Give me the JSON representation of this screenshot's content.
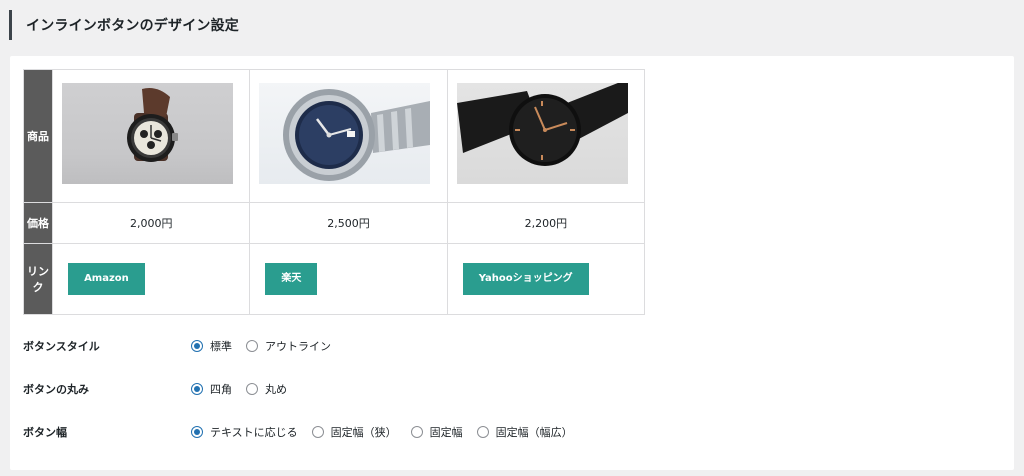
{
  "header": {
    "title": "インラインボタンのデザイン設定"
  },
  "table": {
    "row_labels": {
      "product": "商品",
      "price": "価格",
      "link": "リンク"
    },
    "products": [
      {
        "image": "chronograph-watch-photo",
        "price": "2,000円",
        "button_label": "Amazon"
      },
      {
        "image": "dive-watch-photo",
        "price": "2,500円",
        "button_label": "楽天"
      },
      {
        "image": "black-mesh-watch-photo",
        "price": "2,200円",
        "button_label": "Yahooショッピング"
      }
    ]
  },
  "settings": [
    {
      "label": "ボタンスタイル",
      "options": [
        "標準",
        "アウトライン"
      ],
      "selected": 0
    },
    {
      "label": "ボタンの丸み",
      "options": [
        "四角",
        "丸め"
      ],
      "selected": 0
    },
    {
      "label": "ボタン幅",
      "options": [
        "テキストに応じる",
        "固定幅（狭）",
        "固定幅",
        "固定幅（幅広）"
      ],
      "selected": 0
    }
  ],
  "colors": {
    "button": "#2a9d8f",
    "row_header": "#5b5b5b",
    "radio_active": "#2271b1"
  }
}
